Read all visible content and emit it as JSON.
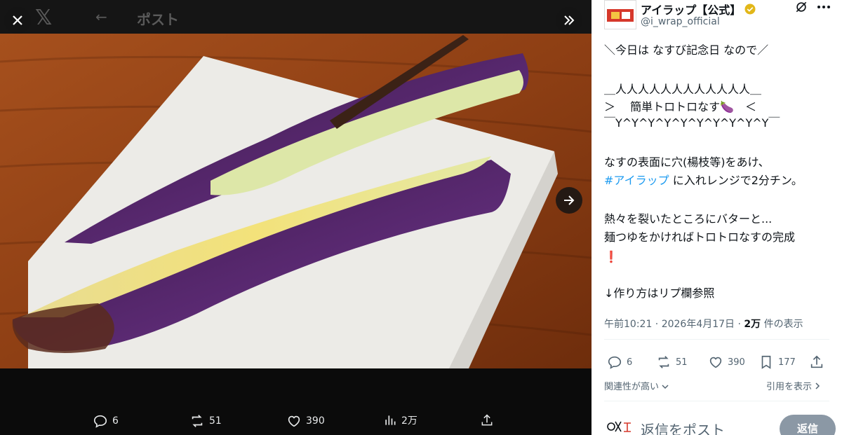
{
  "viewer": {
    "header_title": "ポスト",
    "stats": {
      "replies": "6",
      "reposts": "51",
      "likes": "390",
      "views": "2万"
    }
  },
  "post": {
    "author_name": "アイラップ【公式】",
    "author_handle": "@i_wrap_official",
    "lines": {
      "l1": "＼今日は なすび記念日 なので／",
      "l2": "＿人人人人人人人人人人人人＿",
      "l3": "＞　 簡単トロトロなす🍆　＜",
      "l4": "￣Y^Y^Y^Y^Y^Y^Y^Y^Y^Y￣",
      "l5": "なすの表面に穴(楊枝等)をあけ、",
      "hashtag": "#アイラップ",
      "l6_rest": " に入れレンジで2分チン。",
      "l7": "熱々を裂いたところにバターと...",
      "l8": "麺つゆをかければトロトロなすの完成",
      "l9": "❗",
      "l10": "↓作り方はリプ欄参照"
    },
    "time": "午前10:21 · 2026年4月17日 · ",
    "views_count": "2万",
    "views_label": " 件の表示",
    "stats": {
      "replies": "6",
      "reposts": "51",
      "likes": "390",
      "bookmarks": "177"
    },
    "sort_label": "関連性が高い",
    "quote_label": "引用を表示",
    "reply_placeholder": "返信をポスト",
    "reply_button": "返信"
  },
  "icons": [
    "close-icon",
    "x-logo-icon",
    "back-arrow-icon",
    "collapse-icon",
    "next-arrow-icon",
    "reply-icon",
    "repost-icon",
    "like-icon",
    "views-icon",
    "share-icon",
    "bookmark-icon",
    "verified-badge-icon",
    "grok-icon",
    "more-icon",
    "chevron-down-icon",
    "chevron-right-icon"
  ],
  "colors": {
    "accent": "#1d9bf0",
    "verified": "#e2b719",
    "viewer_bg": "#000000",
    "panel_bg": "#ffffff"
  }
}
